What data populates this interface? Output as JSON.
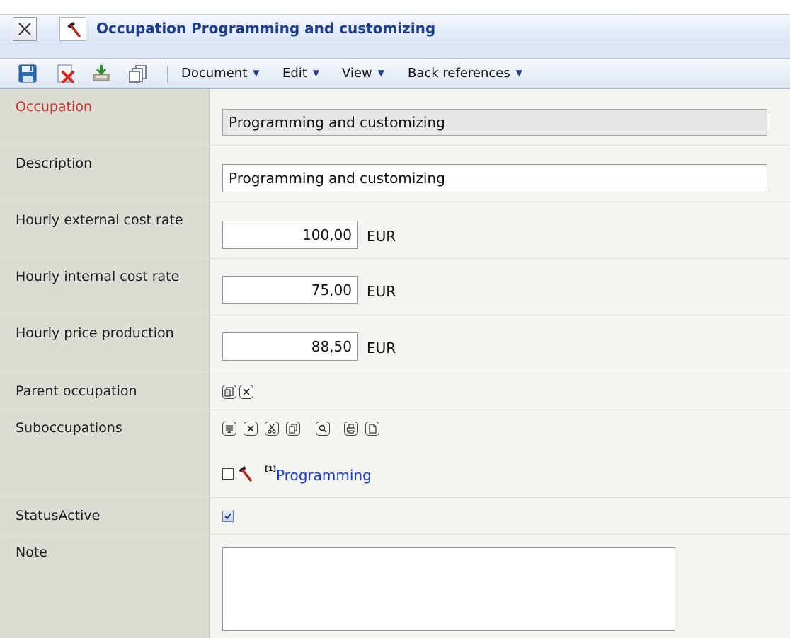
{
  "title": {
    "text": "Occupation Programming and customizing",
    "icon": "hammer-icon"
  },
  "toolbar": {
    "icons": [
      "save-icon",
      "delete-icon",
      "export-icon",
      "copy-icon"
    ],
    "menus": [
      {
        "label": "Document"
      },
      {
        "label": "Edit"
      },
      {
        "label": "View"
      },
      {
        "label": "Back references"
      }
    ]
  },
  "form": {
    "occupation": {
      "label": "Occupation",
      "value": "Programming and customizing"
    },
    "description": {
      "label": "Description",
      "value": "Programming and customizing"
    },
    "external_rate": {
      "label": "Hourly external cost rate",
      "value": "100,00",
      "unit": "EUR"
    },
    "internal_rate": {
      "label": "Hourly internal cost rate",
      "value": "75,00",
      "unit": "EUR"
    },
    "price_production": {
      "label": "Hourly price production",
      "value": "88,50",
      "unit": "EUR"
    },
    "parent_occupation": {
      "label": "Parent occupation",
      "buttons": [
        "select-icon",
        "clear-icon"
      ]
    },
    "suboccupations": {
      "label": "Suboccupations",
      "buttons": [
        "list-icon",
        "remove-icon",
        "cut-icon",
        "copy-icon",
        "search-icon",
        "print-icon",
        "new-icon"
      ],
      "items": [
        {
          "badge": "[1]",
          "label": "Programming",
          "checked": false
        }
      ]
    },
    "status_active": {
      "label": "StatusActive",
      "checked": true
    },
    "note": {
      "label": "Note",
      "value": ""
    }
  },
  "colors": {
    "required_label": "#c8322b",
    "title": "#1c3e8c",
    "link": "#1a3fd0",
    "label_bg": "#dcdcd4"
  }
}
